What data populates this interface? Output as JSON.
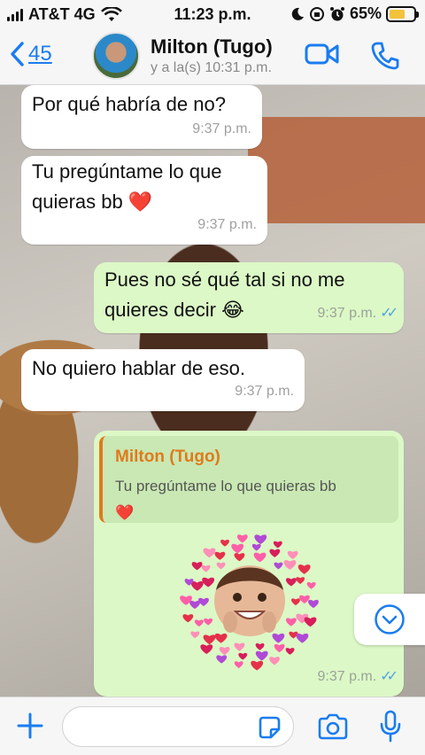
{
  "status_bar": {
    "carrier": "AT&T 4G",
    "time": "11:23 p.m.",
    "battery": "65%",
    "battery_level": 0.65
  },
  "header": {
    "back_count": "45",
    "contact_name": "Milton (Tugo)",
    "contact_status": "y a la(s) 10:31 p.m."
  },
  "messages": [
    {
      "direction": "in",
      "text": "Por qué habría de no?",
      "time": "9:37 p.m."
    },
    {
      "direction": "in",
      "text_line1": "Tu pregúntame lo que",
      "text_line2": "quieras bb",
      "emoji": "❤️",
      "time": "9:37 p.m."
    },
    {
      "direction": "out",
      "text_line1": "Pues no sé qué tal si no me",
      "text_line2": "quieres decir",
      "emoji": "😂",
      "time": "9:37 p.m.",
      "ticks": "✓✓"
    },
    {
      "direction": "in",
      "text": "No quiero hablar de eso.",
      "time": "9:37 p.m."
    },
    {
      "direction": "out",
      "type": "sticker-reply",
      "quote_author": "Milton (Tugo)",
      "quote_text": "Tu pregúntame lo que quieras bb",
      "quote_emoji": "❤️",
      "time": "9:37 p.m.",
      "ticks": "✓✓"
    }
  ],
  "input": {
    "placeholder": ""
  },
  "colors": {
    "accent": "#1a7cf0",
    "outgoing_bubble": "#dcf8c6",
    "incoming_bubble": "#ffffff",
    "quote_author": "#e07a1c",
    "read_ticks": "#4fa3e0"
  },
  "icons": [
    "signal-icon",
    "wifi-icon",
    "moon-icon",
    "orientation-lock-icon",
    "alarm-icon",
    "battery-icon",
    "back-chevron-icon",
    "video-call-icon",
    "phone-icon",
    "scroll-down-icon",
    "plus-icon",
    "sticker-icon",
    "camera-icon",
    "microphone-icon"
  ]
}
